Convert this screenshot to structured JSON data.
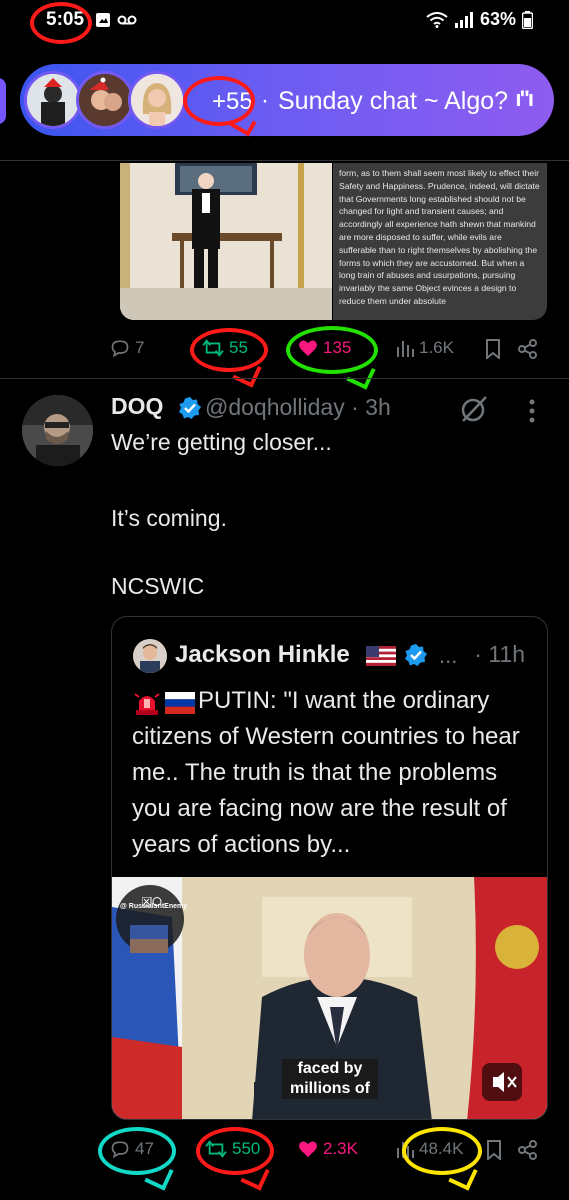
{
  "status_bar": {
    "time": "5:05",
    "battery": "63%",
    "icons": [
      "screenshot-icon",
      "voicemail-icon",
      "wifi-icon",
      "signal-icon",
      "battery-icon"
    ]
  },
  "space": {
    "listener_count": "+55",
    "separator": "·",
    "title": "Sunday chat ~ Algo?",
    "menu_glyph": "ı\"ı",
    "color_start": "#3b55f0",
    "color_end": "#8e5cf0"
  },
  "prev_tweet": {
    "document_text": "form, as to them shall seem most likely to effect their Safety and Happiness. Prudence, indeed, will dictate that Governments long established should not be changed for light and transient causes; and accordingly all experience hath shewn that mankind are more disposed to suffer, while evils are sufferable than to right themselves by abolishing the forms to which they are accustomed. But when a long train of abuses and usurpations, pursuing invariably the same Object evinces a design to reduce them under absolute",
    "replies": "7",
    "reposts": "55",
    "likes": "135",
    "views": "1.6K"
  },
  "tweet": {
    "name": "DOQ",
    "handle": "@doqholliday · 3h",
    "body_line1": "We’re getting closer...",
    "body_line2": "It’s coming.",
    "body_line3": "NCSWIC",
    "replies": "47",
    "reposts": "550",
    "likes": "2.3K",
    "views": "48.4K"
  },
  "quote": {
    "name": "Jackson Hinkle",
    "more": "...",
    "time": "· 11h",
    "text": "PUTIN: \"I want the ordinary citizens of Western countries to hear me.. The truth is that the problems you are facing now are the result of years of actions by...",
    "video_caption_line1": "faced by",
    "video_caption_line2": "millions of",
    "watermark": "@ RussiaIsntEnemy"
  },
  "colors": {
    "repost_green": "#00ba7c",
    "like_pink": "#f91880",
    "verified_blue": "#1d9bf0",
    "annotation_red": "#ff1a1a",
    "annotation_green": "#22e000",
    "annotation_cyan": "#12d8c8",
    "annotation_yellow": "#ffe600"
  }
}
